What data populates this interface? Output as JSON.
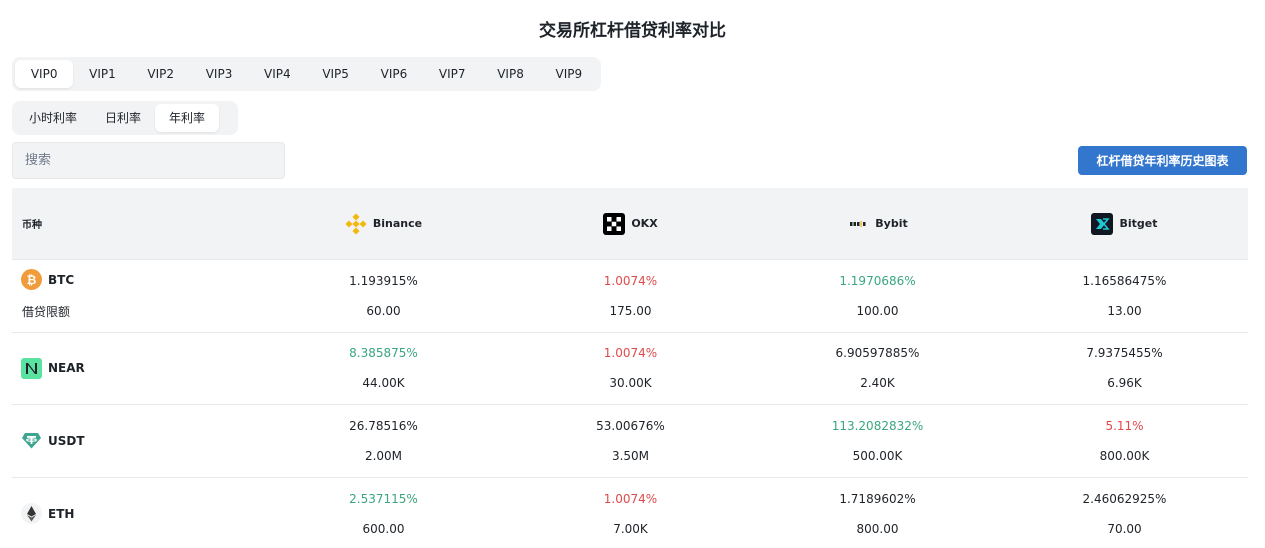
{
  "title": "交易所杠杆借贷利率对比",
  "vip_tabs": [
    "VIP0",
    "VIP1",
    "VIP2",
    "VIP3",
    "VIP4",
    "VIP5",
    "VIP6",
    "VIP7",
    "VIP8",
    "VIP9"
  ],
  "vip_active": "VIP0",
  "rate_tabs": [
    "小时利率",
    "日利率",
    "年利率"
  ],
  "rate_active": "年利率",
  "search": {
    "placeholder": "搜索",
    "value": ""
  },
  "history_button": "杠杆借贷年利率历史图表",
  "table": {
    "coin_header": "币种",
    "exchanges": [
      {
        "name": "Binance",
        "icon": "binance-logo-icon"
      },
      {
        "name": "OKX",
        "icon": "okx-logo-icon"
      },
      {
        "name": "Bybit",
        "icon": "bybit-logo-icon"
      },
      {
        "name": "Bitget",
        "icon": "bitget-logo-icon"
      }
    ],
    "rows": [
      {
        "coin": "BTC",
        "coin_icon": "btc-icon",
        "sub_label": "借贷限额",
        "rates": [
          {
            "value": "1.193915%",
            "color": "black"
          },
          {
            "value": "1.0074%",
            "color": "red"
          },
          {
            "value": "1.1970686%",
            "color": "green"
          },
          {
            "value": "1.16586475%",
            "color": "black"
          }
        ],
        "limits": [
          "60.00",
          "175.00",
          "100.00",
          "13.00"
        ]
      },
      {
        "coin": "NEAR",
        "coin_icon": "near-icon",
        "sub_label": "",
        "rates": [
          {
            "value": "8.385875%",
            "color": "green"
          },
          {
            "value": "1.0074%",
            "color": "red"
          },
          {
            "value": "6.90597885%",
            "color": "black"
          },
          {
            "value": "7.9375455%",
            "color": "black"
          }
        ],
        "limits": [
          "44.00K",
          "30.00K",
          "2.40K",
          "6.96K"
        ]
      },
      {
        "coin": "USDT",
        "coin_icon": "usdt-icon",
        "sub_label": "",
        "rates": [
          {
            "value": "26.78516%",
            "color": "black"
          },
          {
            "value": "53.00676%",
            "color": "black"
          },
          {
            "value": "113.2082832%",
            "color": "green"
          },
          {
            "value": "5.11%",
            "color": "red"
          }
        ],
        "limits": [
          "2.00M",
          "3.50M",
          "500.00K",
          "800.00K"
        ]
      },
      {
        "coin": "ETH",
        "coin_icon": "eth-icon",
        "sub_label": "",
        "rates": [
          {
            "value": "2.537115%",
            "color": "green"
          },
          {
            "value": "1.0074%",
            "color": "red"
          },
          {
            "value": "1.7189602%",
            "color": "black"
          },
          {
            "value": "2.46062925%",
            "color": "black"
          }
        ],
        "limits": [
          "600.00",
          "7.00K",
          "800.00",
          "70.00"
        ]
      }
    ]
  },
  "colors": {
    "accent": "#3376cd",
    "green": "#3aa67e",
    "red": "#e04a4a",
    "header_bg": "#f2f3f5",
    "btc": "#f09c3a",
    "near": "#5ae3a0",
    "usdt": "#3fa591",
    "binance": "#f0b90b"
  }
}
